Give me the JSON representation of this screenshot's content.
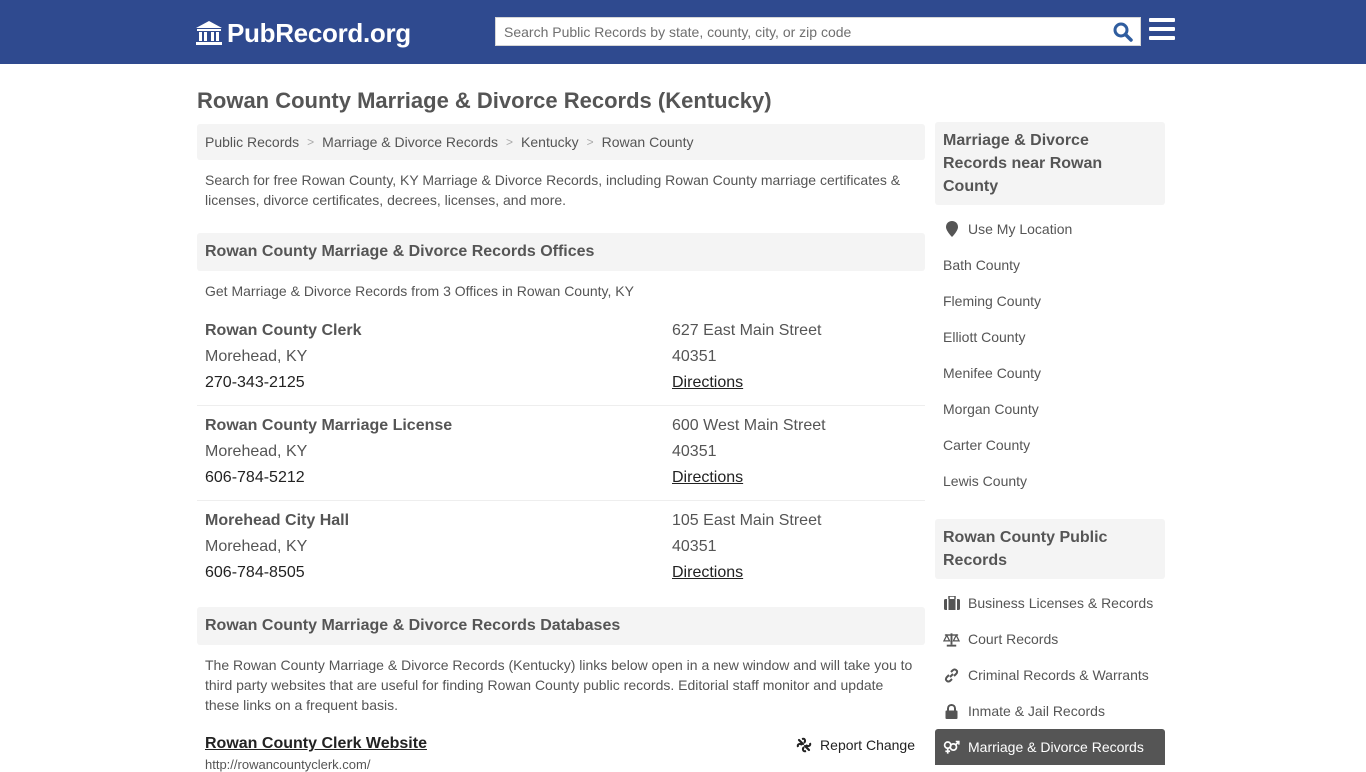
{
  "header": {
    "logo_text": "PubRecord.org",
    "search_placeholder": "Search Public Records by state, county, city, or zip code",
    "brand_color": "#2f4a8f"
  },
  "page_title": "Rowan County Marriage & Divorce Records (Kentucky)",
  "breadcrumb": [
    {
      "label": "Public Records"
    },
    {
      "label": "Marriage & Divorce Records"
    },
    {
      "label": "Kentucky"
    },
    {
      "label": "Rowan County"
    }
  ],
  "intro": "Search for free Rowan County, KY Marriage & Divorce Records, including Rowan County marriage certificates & licenses, divorce certificates, decrees, licenses, and more.",
  "offices_section": {
    "heading": "Rowan County Marriage & Divorce Records Offices",
    "subtext": "Get Marriage & Divorce Records from 3 Offices in Rowan County, KY",
    "offices": [
      {
        "name": "Rowan County Clerk",
        "city": "Morehead, KY",
        "phone": "270-343-2125",
        "street": "627 East Main Street",
        "zip": "40351",
        "directions": "Directions"
      },
      {
        "name": "Rowan County Marriage License",
        "city": "Morehead, KY",
        "phone": "606-784-5212",
        "street": "600 West Main Street",
        "zip": "40351",
        "directions": "Directions"
      },
      {
        "name": "Morehead City Hall",
        "city": "Morehead, KY",
        "phone": "606-784-8505",
        "street": "105 East Main Street",
        "zip": "40351",
        "directions": "Directions"
      }
    ]
  },
  "databases_section": {
    "heading": "Rowan County Marriage & Divorce Records Databases",
    "text": "The Rowan County Marriage & Divorce Records (Kentucky) links below open in a new window and will take you to third party websites that are useful for finding Rowan County public records. Editorial staff monitor and update these links on a frequent basis.",
    "items": [
      {
        "title": "Rowan County Clerk Website",
        "url": "http://rowancountyclerk.com/",
        "report_label": "Report Change"
      }
    ]
  },
  "sidebar": {
    "nearby": {
      "heading": "Marriage & Divorce Records near Rowan County",
      "use_location": "Use My Location",
      "counties": [
        "Bath County",
        "Fleming County",
        "Elliott County",
        "Menifee County",
        "Morgan County",
        "Carter County",
        "Lewis County"
      ]
    },
    "public_records": {
      "heading": "Rowan County Public Records",
      "items": [
        {
          "label": "Business Licenses & Records",
          "icon": "briefcase-icon"
        },
        {
          "label": "Court Records",
          "icon": "scales-icon"
        },
        {
          "label": "Criminal Records & Warrants",
          "icon": "link-icon"
        },
        {
          "label": "Inmate & Jail Records",
          "icon": "lock-icon"
        },
        {
          "label": "Marriage & Divorce Records",
          "icon": "gender-symbols-icon",
          "active": true
        }
      ]
    }
  }
}
